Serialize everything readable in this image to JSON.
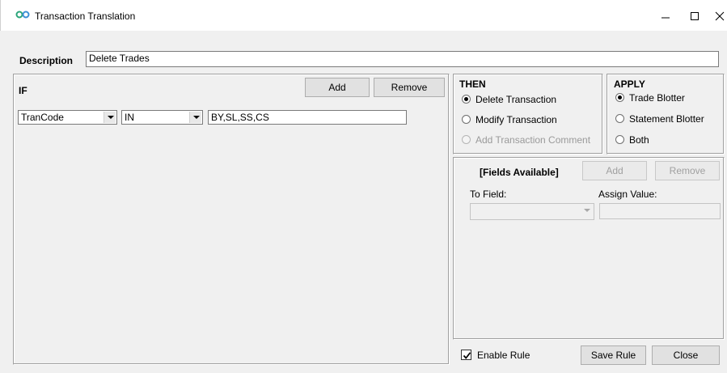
{
  "window": {
    "title": "Transaction Translation",
    "icon": "infinity-icon",
    "accent_color": "#2aa57a"
  },
  "description": {
    "label": "Description",
    "value": "Delete Trades"
  },
  "if_section": {
    "heading": "IF",
    "add_label": "Add",
    "remove_label": "Remove",
    "condition": {
      "field": "TranCode",
      "operator": "IN",
      "value": "BY,SL,SS,CS"
    }
  },
  "then_section": {
    "heading": "THEN",
    "options": [
      {
        "label": "Delete Transaction",
        "checked": true,
        "enabled": true
      },
      {
        "label": "Modify Transaction",
        "checked": false,
        "enabled": true
      },
      {
        "label": "Add Transaction Comment",
        "checked": false,
        "enabled": false
      }
    ]
  },
  "apply_section": {
    "heading": "APPLY",
    "options": [
      {
        "label": "Trade Blotter",
        "checked": true
      },
      {
        "label": "Statement Blotter",
        "checked": false
      },
      {
        "label": "Both",
        "checked": false
      }
    ]
  },
  "fields_section": {
    "heading": "[Fields Available]",
    "add_label": "Add",
    "remove_label": "Remove",
    "to_field_label": "To Field:",
    "to_field_value": "",
    "assign_value_label": "Assign Value:",
    "assign_value": ""
  },
  "footer": {
    "enable_rule_label": "Enable Rule",
    "enable_rule_checked": true,
    "save_label": "Save Rule",
    "close_label": "Close"
  }
}
